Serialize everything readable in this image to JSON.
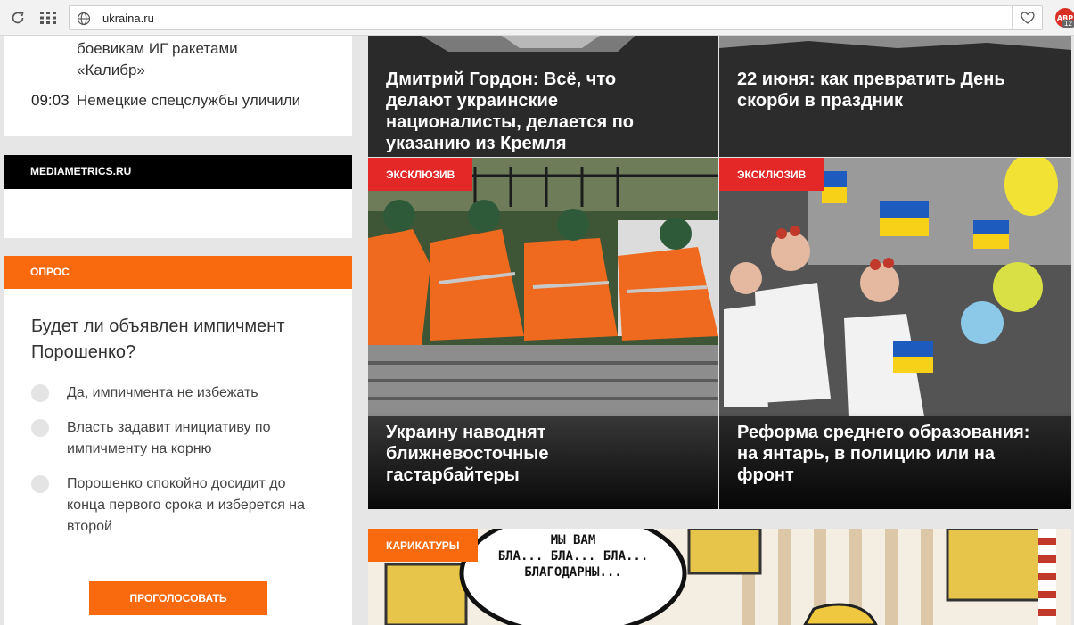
{
  "browser": {
    "url": "ukraina.ru",
    "adblock_label": "ABP",
    "adblock_count": "12"
  },
  "news": {
    "continued_line1": "боевикам ИГ ракетами",
    "continued_line2": "«Калибр»",
    "time": "09:03",
    "headline": "Немецкие спецслужбы уличили"
  },
  "mediametrics": {
    "label": "MEDIAMETRICS.RU"
  },
  "poll": {
    "header": "ОПРОС",
    "question": "Будет ли объявлен импичмент Порошенко?",
    "options": [
      "Да, импичмента не избежать",
      "Власть задавит инициативу по импичменту на корню",
      "Порошенко спокойно досидит до конца первого срока и изберется на второй"
    ],
    "vote_button": "ПРОГОЛОСОВАТЬ"
  },
  "tiles": [
    {
      "title": "Дмитрий Гордон: Всё, что делают украинские националисты, делается по указанию из Кремля"
    },
    {
      "title": "22 июня: как превратить День скорби в праздник"
    },
    {
      "tag": "ЭКСКЛЮЗИВ",
      "title": "Украину наводнят ближневосточные гастарбайтеры"
    },
    {
      "tag": "ЭКСКЛЮЗИВ",
      "title": "Реформа среднего образования: на янтарь, в полицию или на фронт"
    }
  ],
  "cartoons": {
    "tag": "КАРИКАТУРЫ",
    "bubble_line1": "МЫ ВАМ",
    "bubble_line2": "БЛА... БЛА... БЛА...",
    "bubble_line3": "БЛАГОДАРНЫ..."
  },
  "colors": {
    "accent_orange": "#f96a0e",
    "exclusive_red": "#e42827"
  }
}
